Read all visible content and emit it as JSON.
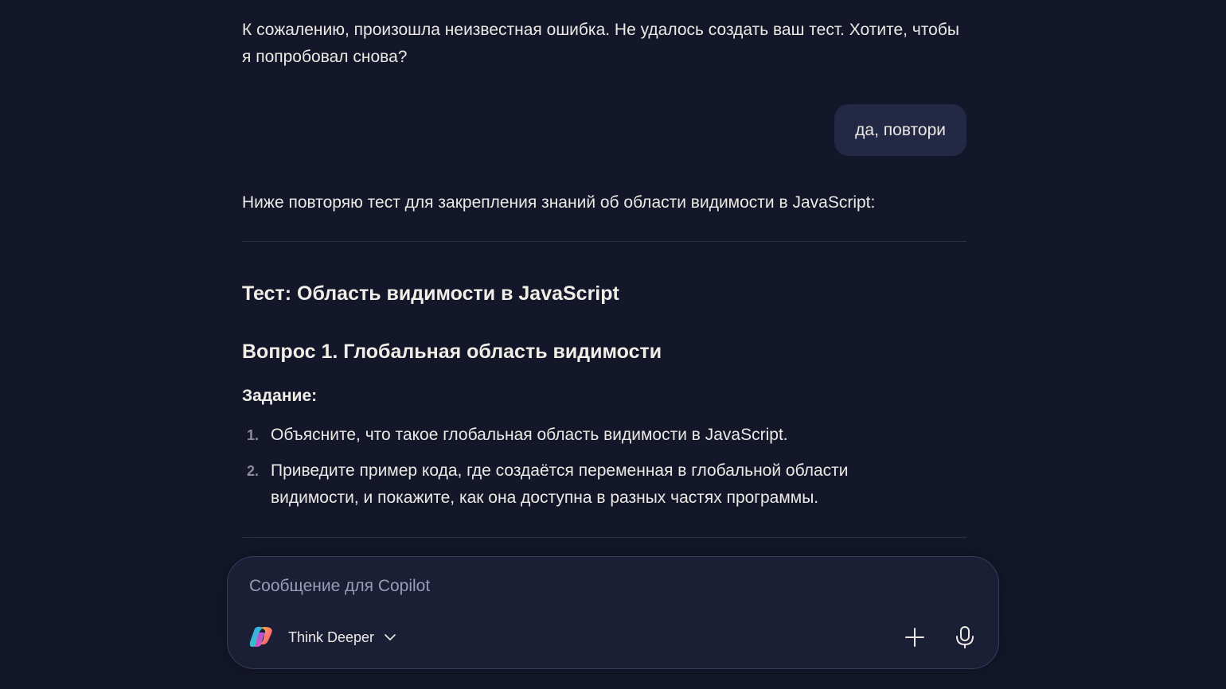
{
  "conversation": {
    "assistant_msg_1": "К сожалению, произошла неизвестная ошибка. Не удалось создать ваш тест. Хотите, чтобы я попробовал снова?",
    "user_msg": "да, повтори",
    "assistant_msg_2": "Ниже повторяю тест для закрепления знаний об области видимости в JavaScript:",
    "test_title": "Тест: Область видимости в JavaScript",
    "question_title": "Вопрос 1. Глобальная область видимости",
    "task_label": "Задание:",
    "task_items": [
      {
        "num": "1.",
        "text": "Объясните, что такое глобальная область видимости в JavaScript."
      },
      {
        "num": "2.",
        "text": "Приведите пример кода, где создаётся переменная в глобальной области видимости, и покажите, как она доступна в разных частях программы."
      }
    ]
  },
  "composer": {
    "placeholder": "Сообщение для Copilot",
    "mode_label": "Think Deeper",
    "icons": [
      "copilot-logo-icon",
      "chevron-down-icon",
      "plus-icon",
      "microphone-icon"
    ]
  },
  "colors": {
    "background": "#14172a",
    "user_bubble": "#232845",
    "composer_bg": "#1b1f35",
    "text": "#ece9e4"
  }
}
